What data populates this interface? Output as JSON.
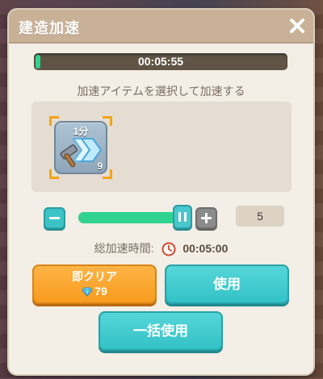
{
  "dialog": {
    "title": "建造加速"
  },
  "progress": {
    "time_text": "00:05:55",
    "fraction": 0.02
  },
  "hint": "加速アイテムを選択して加速する",
  "item": {
    "label": "1分",
    "count": "9",
    "icon": "speedup-hammer-icon"
  },
  "slider": {
    "fraction": 1.0,
    "quantity": "5"
  },
  "total": {
    "label": "総加速時間:",
    "time": "00:05:00"
  },
  "buttons": {
    "instant_clear_label": "即クリア",
    "instant_clear_cost": "79",
    "use_label": "使用",
    "bulk_use_label": "一括使用"
  },
  "colors": {
    "accent_teal": "#3cc3c6",
    "accent_orange": "#f69a1c",
    "progress_green": "#2fd38f"
  }
}
